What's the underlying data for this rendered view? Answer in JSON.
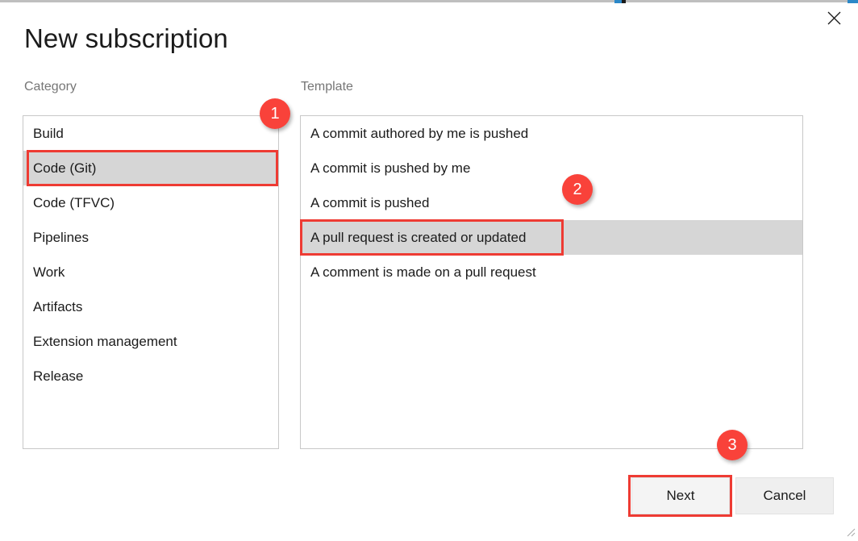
{
  "dialog": {
    "title": "New subscription",
    "close_icon": "close-icon"
  },
  "category_section": {
    "label": "Category",
    "items": [
      {
        "label": "Build",
        "selected": false
      },
      {
        "label": "Code (Git)",
        "selected": true
      },
      {
        "label": "Code (TFVC)",
        "selected": false
      },
      {
        "label": "Pipelines",
        "selected": false
      },
      {
        "label": "Work",
        "selected": false
      },
      {
        "label": "Artifacts",
        "selected": false
      },
      {
        "label": "Extension management",
        "selected": false
      },
      {
        "label": "Release",
        "selected": false
      }
    ]
  },
  "template_section": {
    "label": "Template",
    "items": [
      {
        "label": "A commit authored by me is pushed",
        "selected": false
      },
      {
        "label": "A commit is pushed by me",
        "selected": false
      },
      {
        "label": "A commit is pushed",
        "selected": false
      },
      {
        "label": "A pull request is created or updated",
        "selected": true
      },
      {
        "label": "A comment is made on a pull request",
        "selected": false
      }
    ]
  },
  "footer": {
    "next_label": "Next",
    "cancel_label": "Cancel"
  },
  "annotations": {
    "badges": [
      {
        "number": "1"
      },
      {
        "number": "2"
      },
      {
        "number": "3"
      }
    ],
    "color": "#f9423a",
    "box_color": "#ee3b33"
  },
  "colors": {
    "selection_background": "#d6d6d6",
    "panel_border": "#c8c8c8",
    "label_text": "#767676",
    "body_text": "#1b1b1b",
    "button_background": "#efefef",
    "chrome_blue": "#2b88c8"
  }
}
